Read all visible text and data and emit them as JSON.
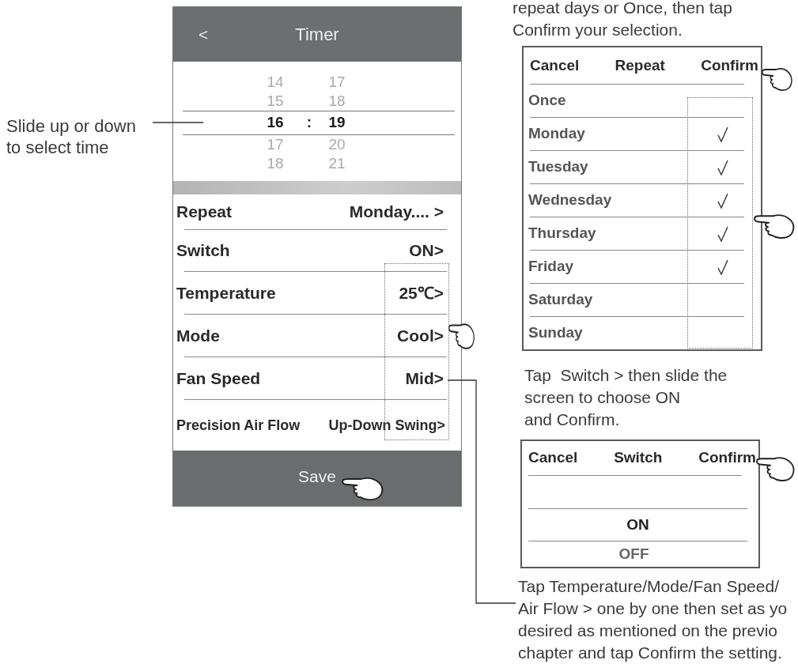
{
  "time_hint": {
    "lines": [
      "Slide up or down",
      "to select time"
    ]
  },
  "timer_screen": {
    "back": "<",
    "title": "Timer",
    "time_picker": {
      "separator": ":",
      "rows": [
        {
          "hour": "14",
          "minute": "17",
          "selected": false
        },
        {
          "hour": "15",
          "minute": "18",
          "selected": false
        },
        {
          "hour": "16",
          "minute": "19",
          "selected": true
        },
        {
          "hour": "17",
          "minute": "20",
          "selected": false
        },
        {
          "hour": "18",
          "minute": "21",
          "selected": false
        }
      ]
    },
    "settings": [
      {
        "label": "Repeat",
        "value": "Monday.... >"
      },
      {
        "label": "Switch",
        "value": "ON>"
      },
      {
        "label": "Temperature",
        "value": "25℃>"
      },
      {
        "label": "Mode",
        "value": "Cool>"
      },
      {
        "label": "Fan Speed",
        "value": "Mid>"
      },
      {
        "label": "Precision Air Flow",
        "value": "Up-Down Swing>"
      }
    ],
    "save_button": "Save"
  },
  "repeat_hint": {
    "lines": [
      "repeat days or Once, then tap",
      "Confirm your selection."
    ]
  },
  "repeat_dialog": {
    "cancel": "Cancel",
    "title": "Repeat",
    "confirm": "Confirm",
    "options": [
      {
        "label": "Once",
        "checked": false
      },
      {
        "label": "Monday",
        "checked": true
      },
      {
        "label": "Tuesday",
        "checked": true
      },
      {
        "label": "Wednesday",
        "checked": true
      },
      {
        "label": "Thursday",
        "checked": true
      },
      {
        "label": "Friday",
        "checked": true
      },
      {
        "label": "Saturday",
        "checked": false
      },
      {
        "label": "Sunday",
        "checked": false
      }
    ]
  },
  "switch_hint": {
    "lines": [
      "Tap  Switch > then slide the",
      "screen to choose ON",
      "and Confirm."
    ]
  },
  "switch_dialog": {
    "cancel": "Cancel",
    "title": "Switch",
    "confirm": "Confirm",
    "options": [
      {
        "label": "ON",
        "selected": true
      },
      {
        "label": "OFF",
        "selected": false
      }
    ]
  },
  "settings_hint": {
    "lines": [
      "Tap Temperature/Mode/Fan Speed/",
      "Air Flow > one by one then set as yo",
      "desired as mentioned on the previo",
      "chapter and tap Confirm the setting."
    ]
  }
}
